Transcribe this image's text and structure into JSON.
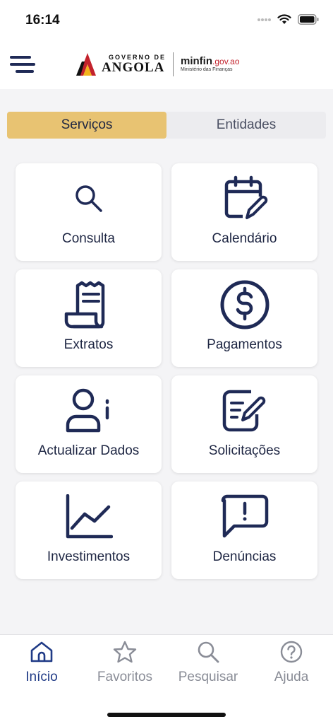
{
  "status_bar": {
    "time": "16:14",
    "icons": [
      "signal-icon",
      "wifi-icon",
      "battery-icon"
    ]
  },
  "header": {
    "menu_icon": "hamburger-menu-icon",
    "logo": {
      "gov_top": "GOVERNO DE",
      "gov_main": "ANGOLA",
      "minfin_main": "minfin",
      "minfin_domain": ".gov.ao",
      "minfin_sub": "Ministério das Finanças"
    }
  },
  "tabs": [
    {
      "label": "Serviços",
      "active": true
    },
    {
      "label": "Entidades",
      "active": false
    }
  ],
  "services": [
    {
      "label": "Consulta",
      "icon": "search-icon"
    },
    {
      "label": "Calendário",
      "icon": "calendar-edit-icon"
    },
    {
      "label": "Extratos",
      "icon": "receipt-icon"
    },
    {
      "label": "Pagamentos",
      "icon": "dollar-icon"
    },
    {
      "label": "Actualizar Dados",
      "icon": "user-info-icon"
    },
    {
      "label": "Solicitações",
      "icon": "form-edit-icon"
    },
    {
      "label": "Investimentos",
      "icon": "chart-line-icon"
    },
    {
      "label": "Denúncias",
      "icon": "report-message-icon"
    }
  ],
  "bottom_nav": [
    {
      "label": "Início",
      "icon": "home-icon",
      "active": true
    },
    {
      "label": "Favoritos",
      "icon": "star-icon",
      "active": false
    },
    {
      "label": "Pesquisar",
      "icon": "search-icon",
      "active": false
    },
    {
      "label": "Ajuda",
      "icon": "help-icon",
      "active": false
    }
  ],
  "colors": {
    "primary": "#1f2a56",
    "accent": "#e8c372",
    "active_nav": "#1f3a86",
    "inactive": "#8a8d97"
  }
}
